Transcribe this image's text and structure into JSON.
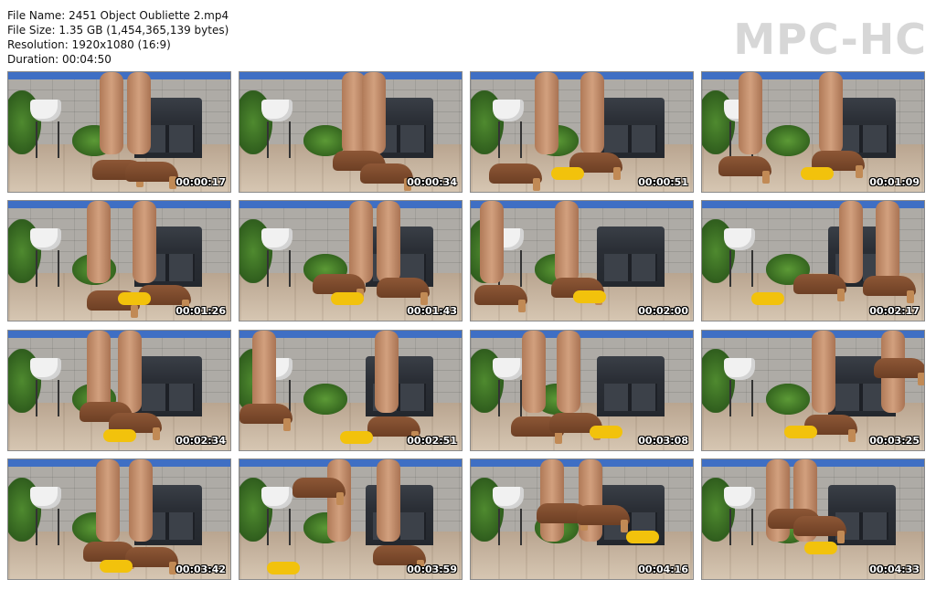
{
  "info": {
    "file_name": "File Name: 2451 Object Oubliette 2.mp4",
    "file_size": "File Size: 1.35 GB (1,454,365,139 bytes)",
    "resolution": "Resolution: 1920x1080 (16:9)",
    "duration": "Duration: 00:04:50"
  },
  "logo": "MPC-HC",
  "thumbnails": [
    {
      "time": "00:00:17"
    },
    {
      "time": "00:00:34"
    },
    {
      "time": "00:00:51"
    },
    {
      "time": "00:01:09"
    },
    {
      "time": "00:01:26"
    },
    {
      "time": "00:01:43"
    },
    {
      "time": "00:02:00"
    },
    {
      "time": "00:02:17"
    },
    {
      "time": "00:02:34"
    },
    {
      "time": "00:02:51"
    },
    {
      "time": "00:03:08"
    },
    {
      "time": "00:03:25"
    },
    {
      "time": "00:03:42"
    },
    {
      "time": "00:03:59"
    },
    {
      "time": "00:04:16"
    },
    {
      "time": "00:04:33"
    }
  ]
}
